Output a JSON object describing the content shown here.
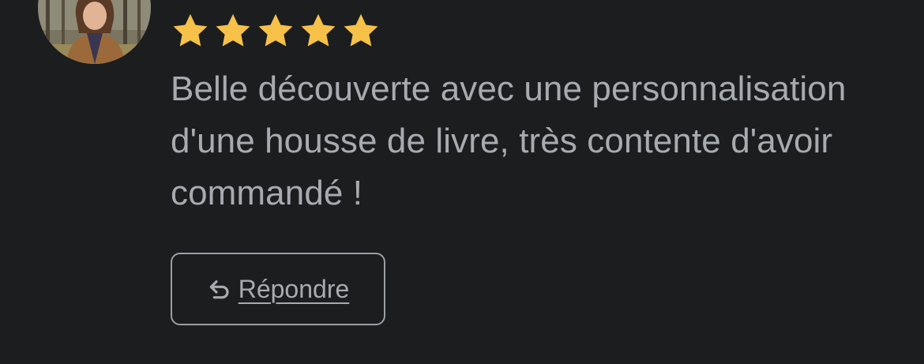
{
  "review": {
    "rating": 5,
    "rating_max": 5,
    "text": "Belle découverte avec une personnalisation d'une housse de livre, très contente d'avoir commandé !",
    "reply_label": "Répondre"
  },
  "icons": {
    "star": "star-icon",
    "reply": "reply-arrow-icon"
  },
  "colors": {
    "background": "#1b1d1f",
    "text": "#a7abb0",
    "star": "#f6c149",
    "button_border": "#9b9fa4"
  }
}
